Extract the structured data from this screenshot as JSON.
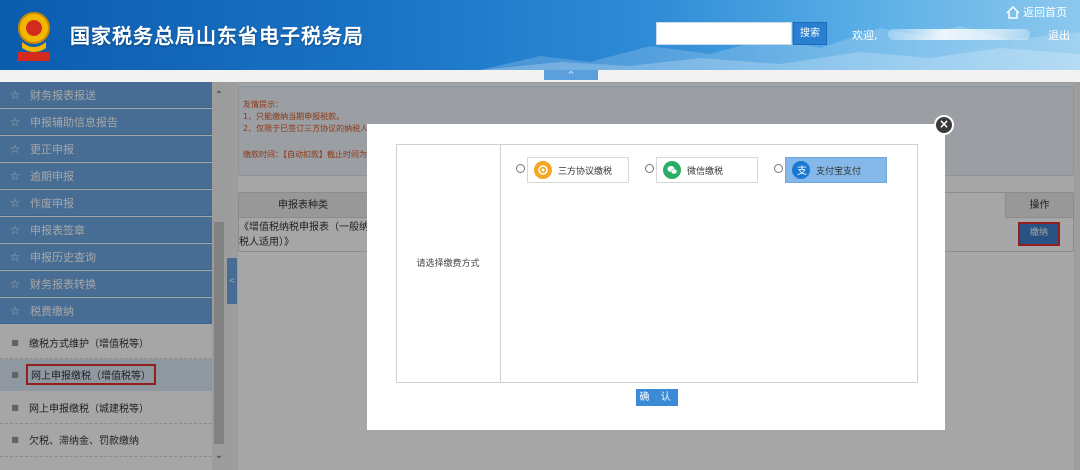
{
  "header": {
    "title": "国家税务总局山东省电子税务局",
    "search_placeholder": "",
    "search_label": "搜索",
    "welcome": "欢迎,",
    "home_label": "返回首页",
    "logout_label": "退出",
    "collapse_glyph": "^"
  },
  "sidebar": {
    "menu": [
      {
        "label": "财务报表报送"
      },
      {
        "label": "申报辅助信息报告"
      },
      {
        "label": "更正申报"
      },
      {
        "label": "逾期申报"
      },
      {
        "label": "作废申报"
      },
      {
        "label": "申报表签章"
      },
      {
        "label": "申报历史查询"
      },
      {
        "label": "财务报表转换"
      },
      {
        "label": "税费缴纳"
      }
    ],
    "sub_items": [
      {
        "label": "缴税方式维护（增值税等）",
        "active": false
      },
      {
        "label": "网上申报缴税（增值税等）",
        "active": true
      },
      {
        "label": "网上申报缴税（城建税等）",
        "active": false
      },
      {
        "label": "欠税、滞纳金、罚款缴纳",
        "active": false
      }
    ],
    "toggle_glyph": "<"
  },
  "notice": {
    "lines": [
      "友情提示：",
      "1、只能缴纳当期申报税款。",
      "2、仅限于已签订三方协议的纳税人",
      "",
      "缴款时间：【自动扣款】截止时间为"
    ]
  },
  "table": {
    "headers": {
      "type": "申报表种类",
      "op": "操作"
    },
    "rows": [
      {
        "type": "《增值税纳税申报表（一般纳税人适用）》",
        "action": "缴纳"
      }
    ]
  },
  "modal": {
    "close_glyph": "×",
    "method_label": "请选择缴费方式",
    "options": [
      {
        "label": "三方协议缴税",
        "icon": "tripartite-icon",
        "color": "#f5a623",
        "selected": false
      },
      {
        "label": "微信缴税",
        "icon": "wechat-icon",
        "color": "#2aae67",
        "selected": false
      },
      {
        "label": "支付宝支付",
        "icon": "alipay-icon",
        "color": "#1a78d3",
        "selected": true
      }
    ],
    "confirm_label": "确 认"
  },
  "colors": {
    "header_blue": "#1a73c6",
    "menu_blue": "#6ea8e4",
    "highlight_red": "#e03030",
    "notice_text": "#d9531e"
  }
}
